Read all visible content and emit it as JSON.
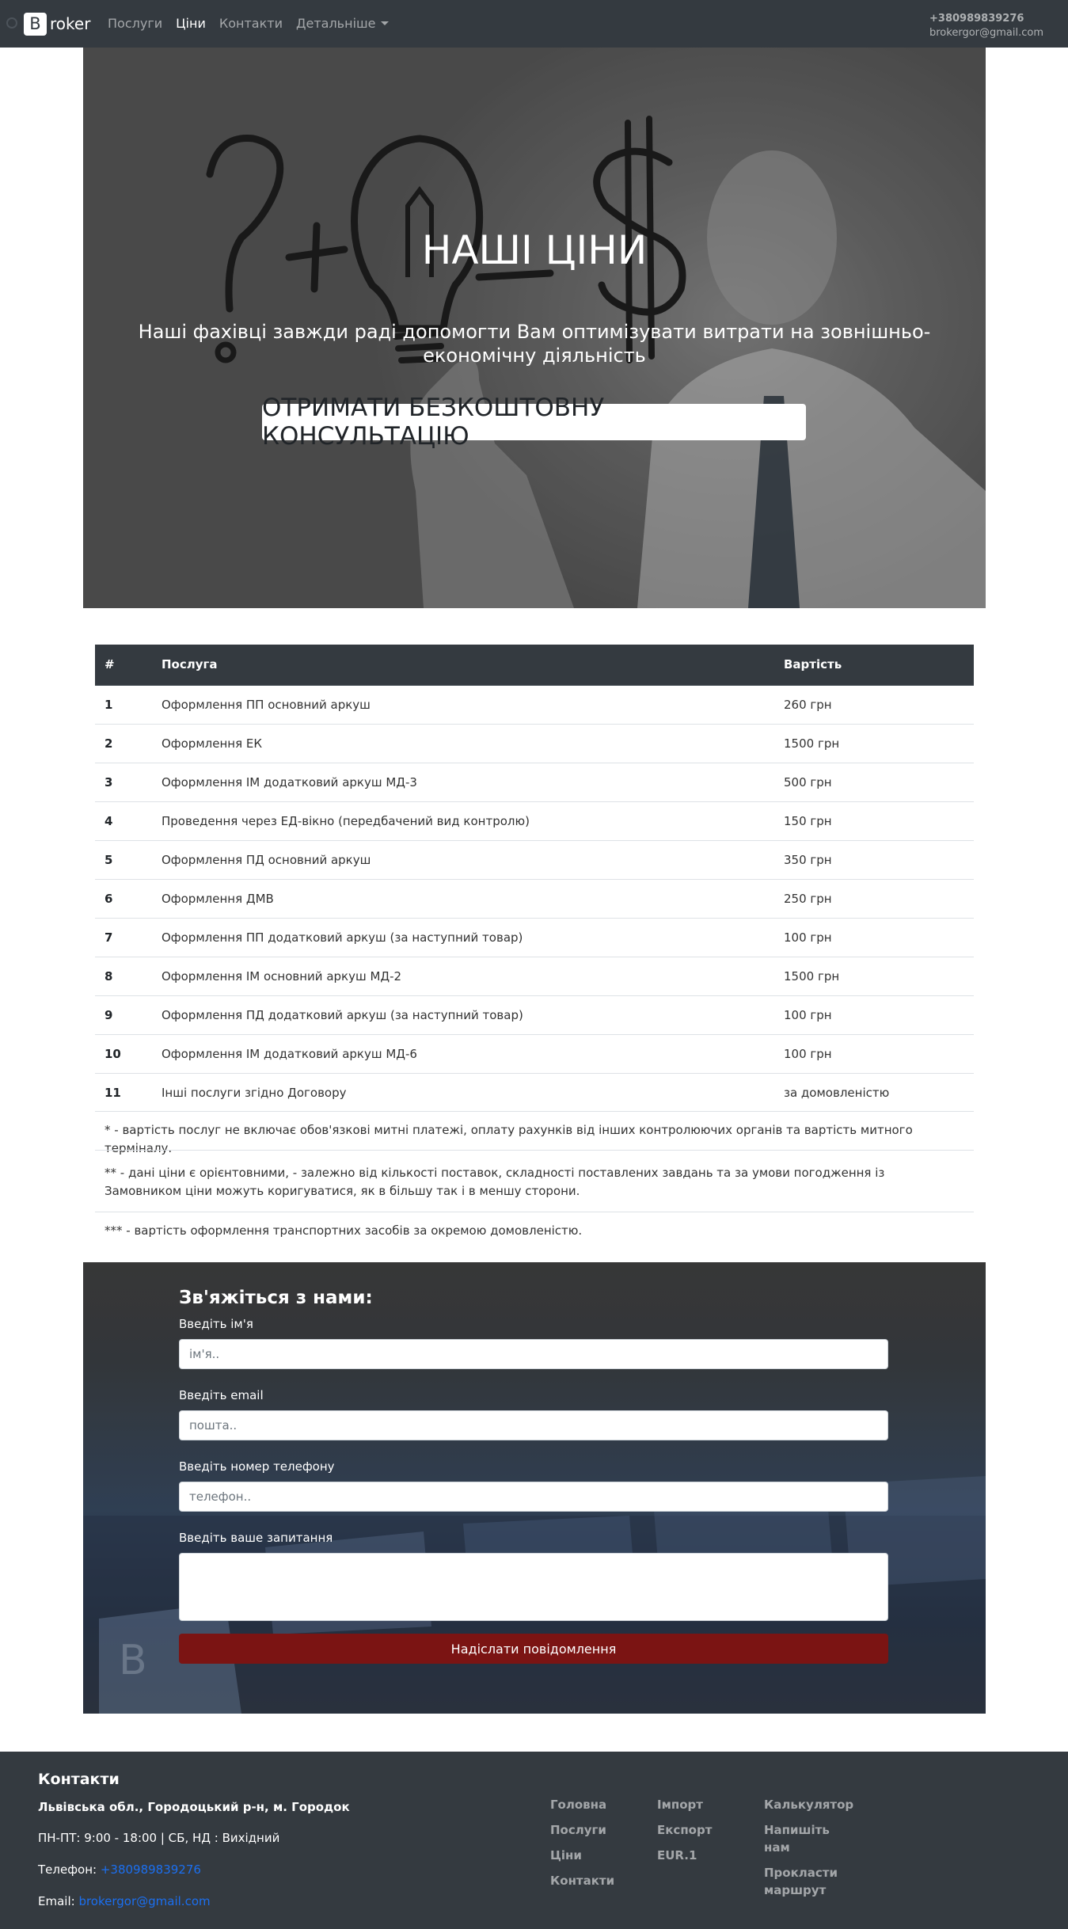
{
  "navbar": {
    "brand_letter": "B",
    "brand_rest": "roker",
    "links": [
      "Послуги",
      "Ціни",
      "Контакти"
    ],
    "dropdown_label": "Детальніше",
    "phone": "+380989839276",
    "email": "brokergor@gmail.com"
  },
  "hero": {
    "title": "НАШІ ЦІНИ",
    "subtitle": "Наші фахівці завжди раді допомогти Вам оптимізувати витрати на зовнішньо-економічну діяльність",
    "cta": "ОТРИМАТИ БЕЗКОШТОВНУ КОНСУЛЬТАЦІЮ"
  },
  "table": {
    "headers": [
      "#",
      "Послуга",
      "Вартість"
    ],
    "rows": [
      {
        "num": "1",
        "service": "Оформлення ПП основний аркуш",
        "price": "260 грн"
      },
      {
        "num": "2",
        "service": "Оформлення ЕК",
        "price": "1500 грн"
      },
      {
        "num": "3",
        "service": "Оформлення ІМ додатковий аркуш МД-3",
        "price": "500 грн"
      },
      {
        "num": "4",
        "service": "Проведення через ЕД-вікно (передбачений вид контролю)",
        "price": "150 грн"
      },
      {
        "num": "5",
        "service": "Оформлення ПД основний аркуш",
        "price": "350 грн"
      },
      {
        "num": "6",
        "service": "Оформлення ДМВ",
        "price": "250 грн"
      },
      {
        "num": "7",
        "service": "Оформлення ПП додатковий аркуш (за наступний товар)",
        "price": "100 грн"
      },
      {
        "num": "8",
        "service": "Оформлення ІМ основний аркуш МД-2",
        "price": "1500 грн"
      },
      {
        "num": "9",
        "service": "Оформлення ПД додатковий аркуш (за наступний товар)",
        "price": "100 грн"
      },
      {
        "num": "10",
        "service": "Оформлення ІМ додатковий аркуш МД-6",
        "price": "100 грн"
      },
      {
        "num": "11",
        "service": "Інші послуги згідно Договору",
        "price": "за домовленістю"
      }
    ],
    "notes": [
      "* - вартість послуг не включає обов'язкові митні платежі, оплату рахунків від інших контролюючих органів та вартість митного терміналу.",
      "** - дані ціни є орієнтовними, - залежно від кількості поставок, складності поставлених завдань та за умови погодження із Замовником ціни можуть коригуватися, як в більшу так і в меншу сторони.",
      "*** - вартість оформлення транспортних засобів за окремою домовленістю."
    ]
  },
  "contact_form": {
    "title": "Зв'яжіться з нами:",
    "name_label": "Введіть ім'я",
    "name_placeholder": "ім'я..",
    "email_label": "Введіть email",
    "email_placeholder": "пошта..",
    "phone_label": "Введіть номер телефону",
    "phone_placeholder": "телефон..",
    "question_label": "Введіть ваше запитання",
    "submit": "Надіслати повідомлення",
    "submit_color": "#7b1413"
  },
  "footer": {
    "title": "Контакти",
    "address": "Львівська обл., Городоцький р-н, м. Городок",
    "hours": "ПН-ПТ: 9:00 - 18:00 | СБ, НД : Вихідний",
    "phone_label": "Телефон: ",
    "phone": "+380989839276",
    "email_label": "Email: ",
    "email": "brokergor@gmail.com",
    "col1": [
      "Головна",
      "Послуги",
      "Ціни",
      "Контакти"
    ],
    "col2": [
      "Імпорт",
      "Експорт",
      "EUR.1"
    ],
    "col3": [
      "Калькулятор",
      "Напишіть нам",
      "Прокласти маршрут"
    ],
    "link_color": "#1b6ff0"
  }
}
